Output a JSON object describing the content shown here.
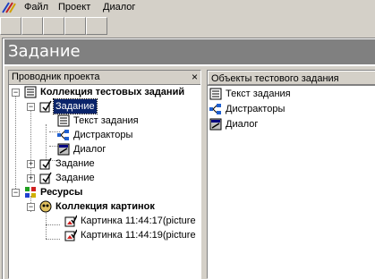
{
  "menu": {
    "file": "Файл",
    "project": "Проект",
    "dialog": "Диалог"
  },
  "window": {
    "title": "Задание"
  },
  "left_pane": {
    "header": "Проводник проекта",
    "close_glyph": "×",
    "tree": {
      "root": "Коллекция тестовых заданий",
      "task_selected": "Задание",
      "task_text": "Текст задания",
      "distractors": "Дистракторы",
      "dialog": "Диалог",
      "task2": "Задание",
      "task3": "Задание",
      "resources": "Ресурсы",
      "images": "Коллекция картинок",
      "pic1": "Картинка 11:44:17(picture",
      "pic2": "Картинка 11:44:19(picture"
    }
  },
  "right_pane": {
    "header": "Объекты тестового задания",
    "items": [
      "Текст задания",
      "Дистракторы",
      "Диалог"
    ]
  },
  "colors": {
    "selection": "#0a246a",
    "title_bar": "#808080",
    "chrome": "#d4d0c8"
  }
}
